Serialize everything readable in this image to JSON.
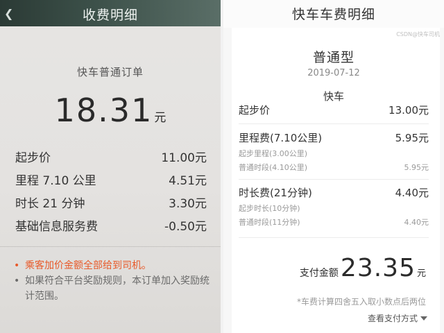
{
  "left_screen": {
    "back_icon": "chevron-left-icon",
    "title": "收费明细",
    "order_type": "快车普通订单",
    "total_amount": "18.31",
    "total_unit": "元",
    "rows": [
      {
        "label": "起步价",
        "value": "11.00元"
      },
      {
        "label": "里程 7.10 公里",
        "value": "4.51元"
      },
      {
        "label": "时长 21 分钟",
        "value": "3.30元"
      },
      {
        "label": "基础信息服务费",
        "value": "-0.50元"
      }
    ],
    "notes": [
      {
        "bullet": "•",
        "text": "乘客加价金额全部给到司机。"
      },
      {
        "bullet": "•",
        "text": "如果符合平台奖励规则，本订单加入奖励统计范围。"
      }
    ],
    "accent_color": "#e85a2a"
  },
  "right_screen": {
    "title": "快车车费明细",
    "watermark": "CSDN@快车司机",
    "car_type": "普通型",
    "date": "2019-07-12",
    "product": "快车",
    "base_fare": {
      "label": "起步价",
      "value": "13.00元"
    },
    "mileage": {
      "label": "里程费(7.10公里)",
      "value": "5.95元",
      "sub": [
        {
          "label": "起步里程(3.00公里)",
          "value": ""
        },
        {
          "label": "普通时段(4.10公里)",
          "value": "5.95元"
        }
      ]
    },
    "duration": {
      "label": "时长费(21分钟)",
      "value": "4.40元",
      "sub": [
        {
          "label": "起步时长(10分钟)",
          "value": ""
        },
        {
          "label": "普通时段(11分钟)",
          "value": "4.40元"
        }
      ]
    },
    "pay_label": "支付金额",
    "pay_amount": "23.35",
    "pay_unit": "元",
    "footnote": "*车费计算四舍五入取小数点后两位",
    "view_payment": "查看支付方式"
  }
}
